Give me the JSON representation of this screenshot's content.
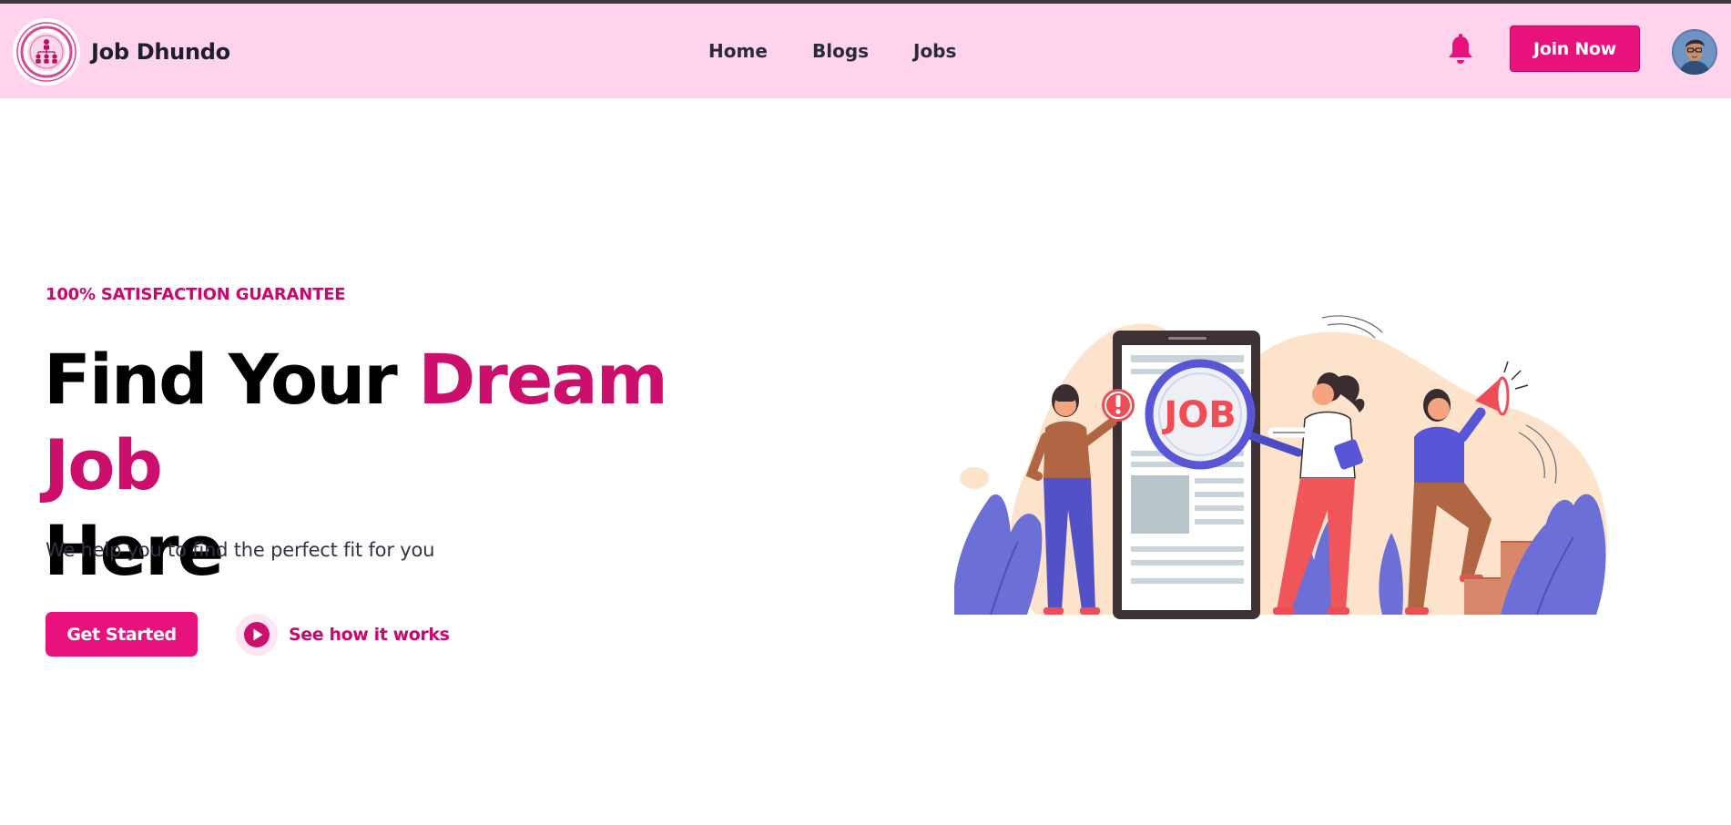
{
  "brand": {
    "name": "Job Dhundo",
    "logo": "org-chart-logo-icon"
  },
  "nav": {
    "links": [
      {
        "label": "Home"
      },
      {
        "label": "Blogs"
      },
      {
        "label": "Jobs"
      }
    ],
    "notification_icon": "bell-icon",
    "join_label": "Join Now"
  },
  "hero": {
    "tagline": "100% SATISFACTION GUARANTEE",
    "headline_start": "Find Your ",
    "headline_accent": "Dream Job",
    "headline_end": "Here",
    "subtitle": "We help you to find the perfect fit for you",
    "primary_cta": "Get Started",
    "secondary_cta": "See how it works",
    "illustration": {
      "sign_text": "JOB"
    }
  },
  "colors": {
    "accent": "#e7127b",
    "accent_text": "#c8086b",
    "navbar_bg": "#ffd3ec"
  }
}
